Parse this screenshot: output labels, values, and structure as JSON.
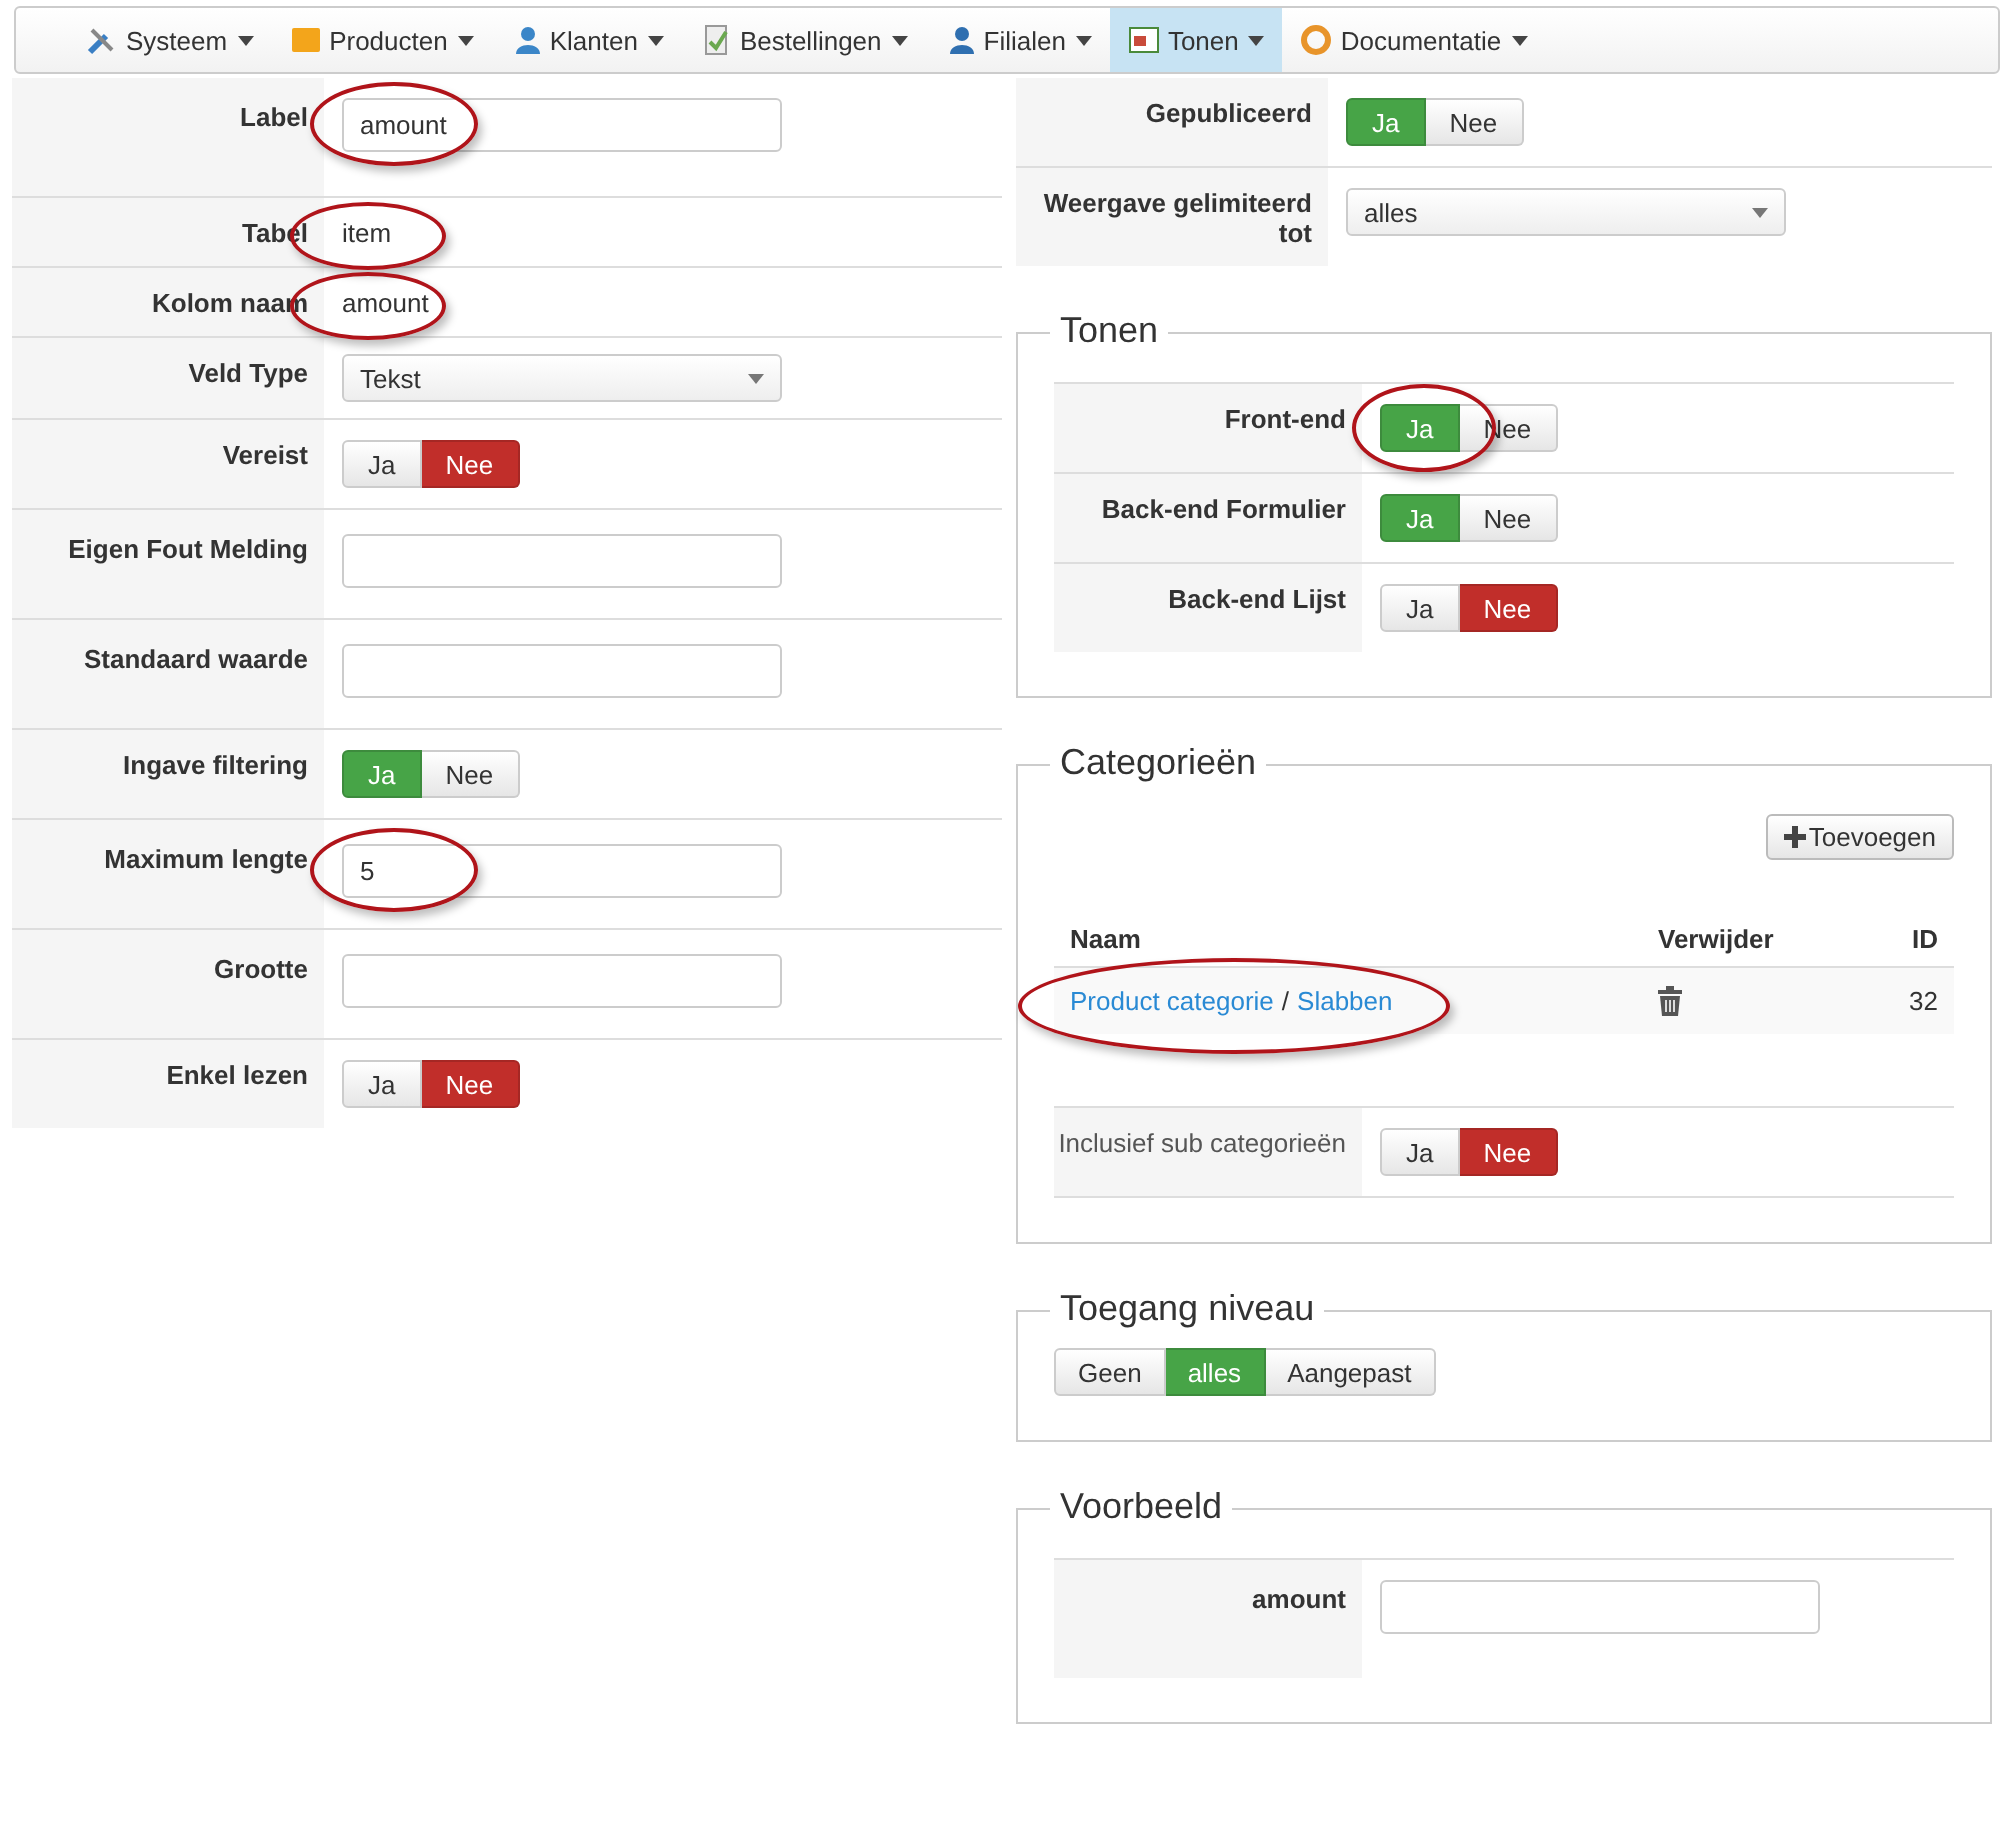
{
  "menu": [
    {
      "label": "Systeem",
      "selected": false
    },
    {
      "label": "Producten",
      "selected": false
    },
    {
      "label": "Klanten",
      "selected": false
    },
    {
      "label": "Bestellingen",
      "selected": false
    },
    {
      "label": "Filialen",
      "selected": false
    },
    {
      "label": "Tonen",
      "selected": true
    },
    {
      "label": "Documentatie",
      "selected": false
    }
  ],
  "left_form": [
    {
      "label": "Label",
      "kind": "input",
      "value": "amount",
      "circled": true
    },
    {
      "label": "Tabel",
      "kind": "text",
      "value": "item",
      "circled": true
    },
    {
      "label": "Kolom naam",
      "kind": "text",
      "value": "amount",
      "circled": true
    },
    {
      "label": "Veld Type",
      "kind": "select",
      "value": "Tekst",
      "circled": false
    },
    {
      "label": "Vereist",
      "kind": "toggle",
      "circled": false,
      "options": [
        {
          "label": "Ja",
          "selected": false
        },
        {
          "label": "Nee",
          "selected": true
        }
      ]
    },
    {
      "label": "Eigen Fout Melding",
      "kind": "input",
      "circled": false
    },
    {
      "label": "Standaard waarde",
      "kind": "input",
      "circled": false
    },
    {
      "label": "Ingave filtering",
      "kind": "toggle",
      "circled": false,
      "options": [
        {
          "label": "Ja",
          "selected": true
        },
        {
          "label": "Nee",
          "selected": false
        }
      ]
    },
    {
      "label": "Maximum lengte",
      "kind": "input",
      "value": "5",
      "circled": true
    },
    {
      "label": "Grootte",
      "kind": "input",
      "circled": false
    },
    {
      "label": "Enkel lezen",
      "kind": "toggle",
      "circled": false,
      "options": [
        {
          "label": "Ja",
          "selected": false
        },
        {
          "label": "Nee",
          "selected": true
        }
      ]
    }
  ],
  "right_top": [
    {
      "label": "Gepubliceerd",
      "kind": "toggle",
      "circled": false,
      "options": [
        {
          "label": "Ja",
          "selected": true
        },
        {
          "label": "Nee",
          "selected": false
        }
      ]
    },
    {
      "label": "Weergave gelimiteerd tot",
      "kind": "select",
      "value": "alles",
      "circled": false
    }
  ],
  "sections": [
    {
      "title": "Tonen",
      "rows": [
        {
          "label": "Front-end",
          "kind": "toggle",
          "circled": true,
          "options": [
            {
              "label": "Ja",
              "selected": true
            },
            {
              "label": "Nee",
              "selected": false
            }
          ]
        },
        {
          "label": "Back-end Formulier",
          "kind": "toggle",
          "circled": false,
          "options": [
            {
              "label": "Ja",
              "selected": true
            },
            {
              "label": "Nee",
              "selected": false
            }
          ]
        },
        {
          "label": "Back-end Lijst",
          "kind": "toggle",
          "circled": false,
          "options": [
            {
              "label": "Ja",
              "selected": false
            },
            {
              "label": "Nee",
              "selected": true
            }
          ]
        }
      ]
    },
    {
      "title": "Categorieën",
      "add_button": "Toevoegen",
      "table": {
        "columns": [
          "Naam",
          "Verwijder",
          "ID"
        ],
        "rows": [
          {
            "name_parts": [
              {
                "kind": "link",
                "text": "Product categorie"
              },
              {
                "kind": "sep",
                "text": "/"
              },
              {
                "kind": "link",
                "text": "Slabben"
              }
            ],
            "id": "32",
            "circled": true
          }
        ]
      },
      "rows": [
        {
          "label": "Inclusief sub categorieën",
          "kind": "toggle",
          "circled": false,
          "options": [
            {
              "label": "Ja",
              "selected": false
            },
            {
              "label": "Nee",
              "selected": true
            }
          ]
        }
      ]
    },
    {
      "title": "Toegang niveau",
      "segments": [
        {
          "label": "Geen",
          "selected": false
        },
        {
          "label": "alles",
          "selected": true
        },
        {
          "label": "Aangepast",
          "selected": false
        }
      ]
    },
    {
      "title": "Voorbeeld",
      "rows": [
        {
          "label": "amount",
          "kind": "input",
          "circled": false
        }
      ]
    }
  ]
}
